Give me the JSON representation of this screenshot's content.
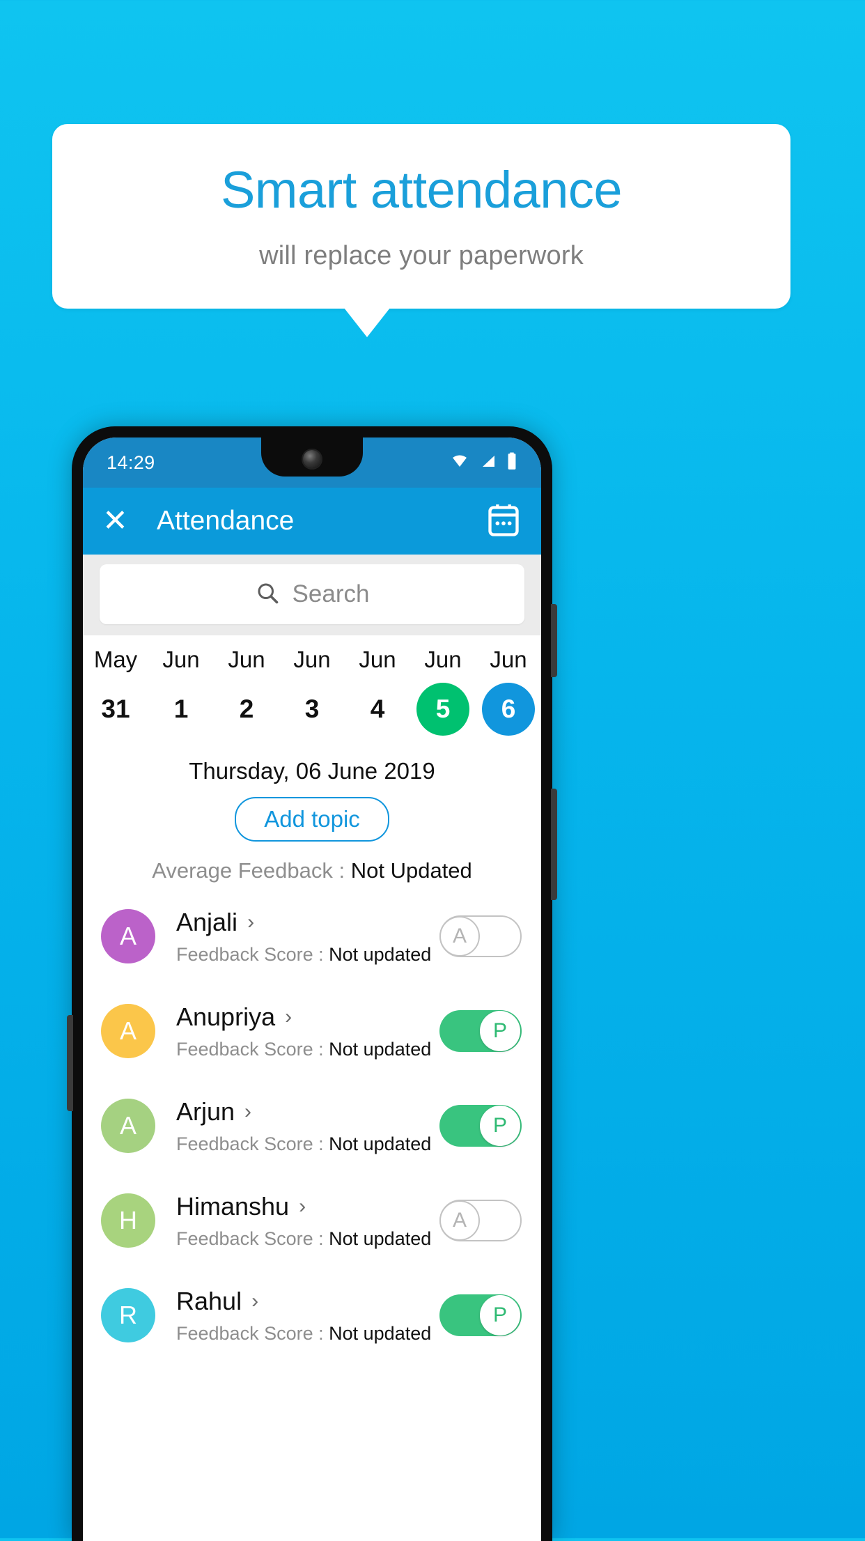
{
  "promo": {
    "title": "Smart attendance",
    "subtitle": "will replace your paperwork"
  },
  "colors": {
    "background_top": "#0fc4f0",
    "background_bottom": "#00a6e4",
    "brand_blue": "#1a9fda",
    "appbar_blue": "#0b9ada",
    "statusbar_blue": "#1987c4",
    "present_green": "#39c47f",
    "selected_green": "#00c170",
    "selected_blue": "#1196dd"
  },
  "phone": {
    "statusbar": {
      "time": "14:29",
      "icons": [
        "wifi-icon",
        "signal-icon",
        "battery-icon"
      ]
    },
    "appbar": {
      "close_icon": "close-icon",
      "title": "Attendance",
      "calendar_icon": "calendar-icon"
    },
    "search": {
      "icon": "search-icon",
      "placeholder": "Search"
    },
    "date_strip": [
      {
        "month": "May",
        "day": "31",
        "state": "normal"
      },
      {
        "month": "Jun",
        "day": "1",
        "state": "normal"
      },
      {
        "month": "Jun",
        "day": "2",
        "state": "normal"
      },
      {
        "month": "Jun",
        "day": "3",
        "state": "normal"
      },
      {
        "month": "Jun",
        "day": "4",
        "state": "normal"
      },
      {
        "month": "Jun",
        "day": "5",
        "state": "green"
      },
      {
        "month": "Jun",
        "day": "6",
        "state": "blue"
      }
    ],
    "selected_date_label": "Thursday, 06 June 2019",
    "add_topic_label": "Add topic",
    "average_feedback": {
      "label": "Average Feedback : ",
      "value": "Not Updated"
    },
    "score_label": "Feedback Score : ",
    "students": [
      {
        "name": "Anjali",
        "initial": "A",
        "avatar_color": "#bb62c9",
        "score_value": "Not updated",
        "attendance": "A",
        "attendance_state": "absent"
      },
      {
        "name": "Anupriya",
        "initial": "A",
        "avatar_color": "#fbc64a",
        "score_value": "Not updated",
        "attendance": "P",
        "attendance_state": "present"
      },
      {
        "name": "Arjun",
        "initial": "A",
        "avatar_color": "#a5d181",
        "score_value": "Not updated",
        "attendance": "P",
        "attendance_state": "present"
      },
      {
        "name": "Himanshu",
        "initial": "H",
        "avatar_color": "#a8d37e",
        "score_value": "Not updated",
        "attendance": "A",
        "attendance_state": "absent"
      },
      {
        "name": "Rahul",
        "initial": "R",
        "avatar_color": "#3fcbe0",
        "score_value": "Not updated",
        "attendance": "P",
        "attendance_state": "present"
      }
    ]
  }
}
